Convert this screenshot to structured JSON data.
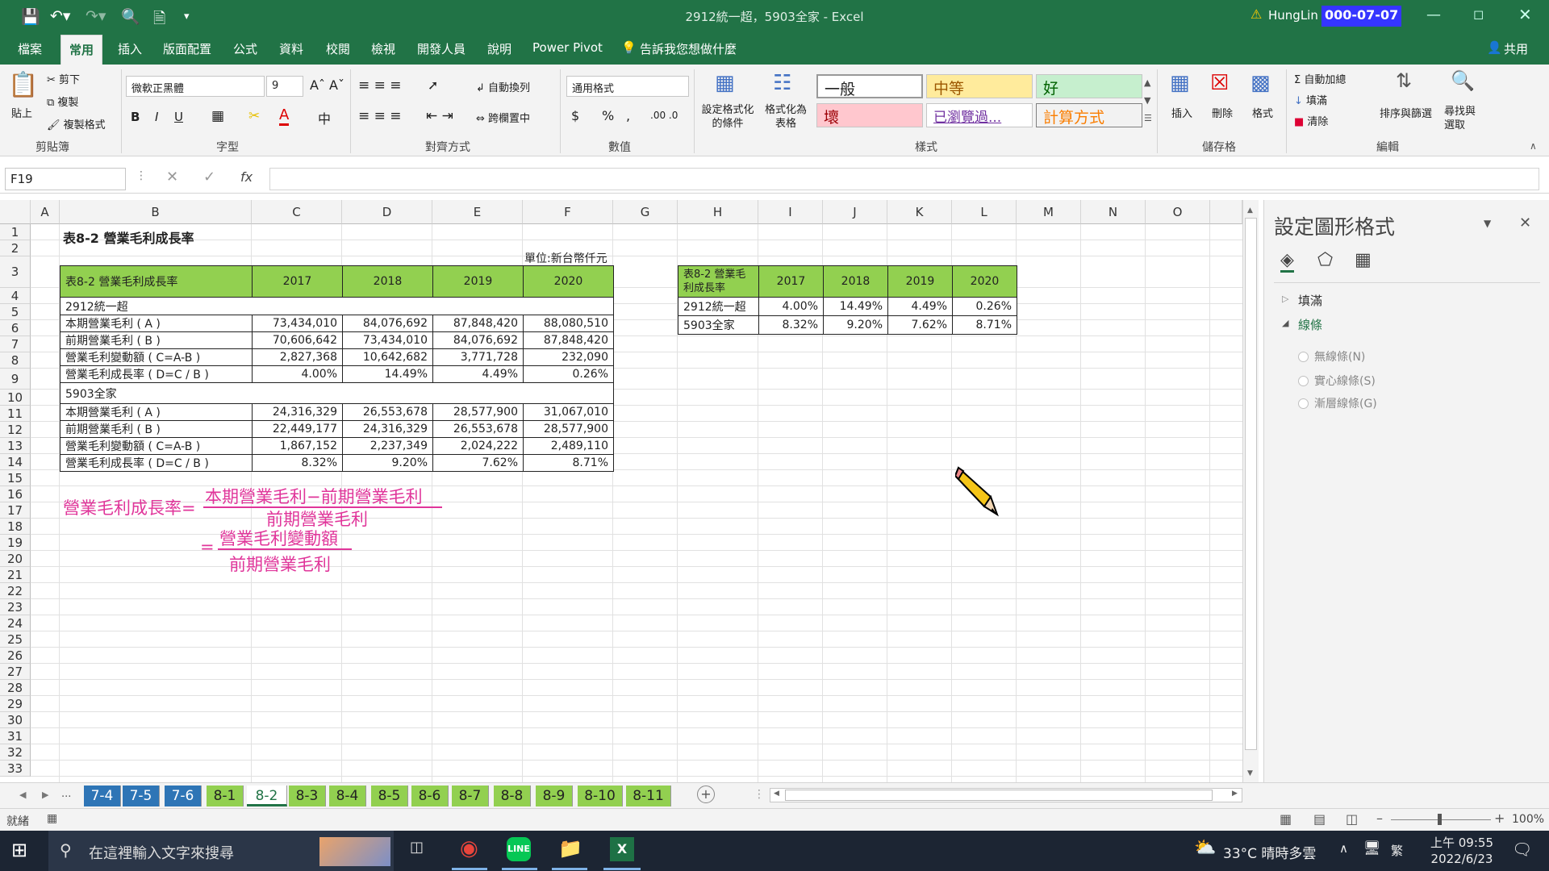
{
  "window": {
    "title": "2912統一超，5903全家 - Excel",
    "user": "HungLin",
    "user_badge": "000-07-07"
  },
  "ribbon_tabs": [
    "檔案",
    "常用",
    "插入",
    "版面配置",
    "公式",
    "資料",
    "校閱",
    "檢視",
    "開發人員",
    "說明",
    "Power Pivot"
  ],
  "active_tab": "常用",
  "tell_me": "告訴我您想做什麼",
  "share": "共用",
  "ribbon": {
    "clipboard": {
      "paste": "貼上",
      "cut": "剪下",
      "copy": "複製",
      "format_painter": "複製格式",
      "label": "剪貼簿"
    },
    "font": {
      "name": "微軟正黑體",
      "size": "9",
      "label": "字型",
      "bold": "B",
      "italic": "I",
      "underline": "U"
    },
    "alignment": {
      "wrap": "自動換列",
      "merge": "跨欄置中",
      "label": "對齊方式"
    },
    "number": {
      "format": "通用格式",
      "label": "數值",
      "currency": "$",
      "percent": "%",
      "comma": ","
    },
    "styles": {
      "conditional": "設定格式化的條件",
      "as_table": "格式化為表格",
      "label": "樣式",
      "cells": [
        "一般",
        "中等",
        "好",
        "壞",
        "已瀏覽過...",
        "計算方式"
      ]
    },
    "cells": {
      "insert": "插入",
      "delete": "刪除",
      "format": "格式",
      "label": "儲存格"
    },
    "editing": {
      "autosum": "自動加總",
      "fill": "填滿",
      "clear": "清除",
      "sort": "排序與篩選",
      "find": "尋找與選取",
      "label": "編輯"
    }
  },
  "formula_bar": {
    "name_box": "F19",
    "formula": ""
  },
  "columns": [
    "A",
    "B",
    "C",
    "D",
    "E",
    "F",
    "G",
    "H",
    "I",
    "J",
    "K",
    "L",
    "M",
    "N",
    "O"
  ],
  "rows": [
    "1",
    "2",
    "3",
    "4",
    "5",
    "6",
    "7",
    "8",
    "9",
    "10",
    "11",
    "12",
    "13",
    "14",
    "15",
    "16",
    "17",
    "18",
    "19",
    "20",
    "21",
    "22",
    "23",
    "24",
    "25",
    "26",
    "27",
    "28",
    "29",
    "30",
    "31",
    "32",
    "33"
  ],
  "sheet": {
    "title": "表8-2 營業毛利成長率",
    "unit": "單位:新台幣仟元",
    "table1": {
      "header": [
        "表8-2 營業毛利成長率",
        "2017",
        "2018",
        "2019",
        "2020"
      ],
      "group1": "2912統一超",
      "rows1": [
        [
          "本期營業毛利 ( A )",
          "73,434,010",
          "84,076,692",
          "87,848,420",
          "88,080,510"
        ],
        [
          "前期營業毛利 ( B )",
          "70,606,642",
          "73,434,010",
          "84,076,692",
          "87,848,420"
        ],
        [
          "營業毛利變動額 ( C=A-B )",
          "2,827,368",
          "10,642,682",
          "3,771,728",
          "232,090"
        ],
        [
          "營業毛利成長率 ( D=C / B )",
          "4.00%",
          "14.49%",
          "4.49%",
          "0.26%"
        ]
      ],
      "group2": "5903全家",
      "rows2": [
        [
          "本期營業毛利 ( A )",
          "24,316,329",
          "26,553,678",
          "28,577,900",
          "31,067,010"
        ],
        [
          "前期營業毛利 ( B )",
          "22,449,177",
          "24,316,329",
          "26,553,678",
          "28,577,900"
        ],
        [
          "營業毛利變動額 ( C=A-B )",
          "1,867,152",
          "2,237,349",
          "2,024,222",
          "2,489,110"
        ],
        [
          "營業毛利成長率 ( D=C / B )",
          "8.32%",
          "9.20%",
          "7.62%",
          "8.71%"
        ]
      ]
    },
    "table2": {
      "header": [
        "表8-2 營業毛利成長率",
        "2017",
        "2018",
        "2019",
        "2020"
      ],
      "rows": [
        [
          "2912統一超",
          "4.00%",
          "14.49%",
          "4.49%",
          "0.26%"
        ],
        [
          "5903全家",
          "8.32%",
          "9.20%",
          "7.62%",
          "8.71%"
        ]
      ]
    },
    "formula": {
      "lhs": "營業毛利成長率=",
      "num1": "本期營業毛利−前期營業毛利",
      "den1": "前期營業毛利",
      "eq2": "=",
      "num2": "營業毛利變動額",
      "den2": "前期營業毛利"
    }
  },
  "format_panel": {
    "title": "設定圖形格式",
    "fill": "填滿",
    "line": "線條",
    "options": [
      "無線條(N)",
      "實心線條(S)",
      "漸層線條(G)"
    ]
  },
  "sheet_tabs": [
    "7-4",
    "7-5",
    "7-6",
    "8-1",
    "8-2",
    "8-3",
    "8-4",
    "8-5",
    "8-6",
    "8-7",
    "8-8",
    "8-9",
    "8-10",
    "8-11"
  ],
  "active_sheet": "8-2",
  "status": {
    "ready": "就緒",
    "zoom": "100%"
  },
  "taskbar": {
    "search": "在這裡輸入文字來搜尋",
    "weather": "33°C 晴時多雲",
    "ime": "繁",
    "time": "上午 09:55",
    "date": "2022/6/23"
  },
  "colors": {
    "excel_green": "#217346",
    "header_green": "#92d050",
    "tab_blue": "#2e75b6",
    "formula_pink": "#e0359a"
  }
}
